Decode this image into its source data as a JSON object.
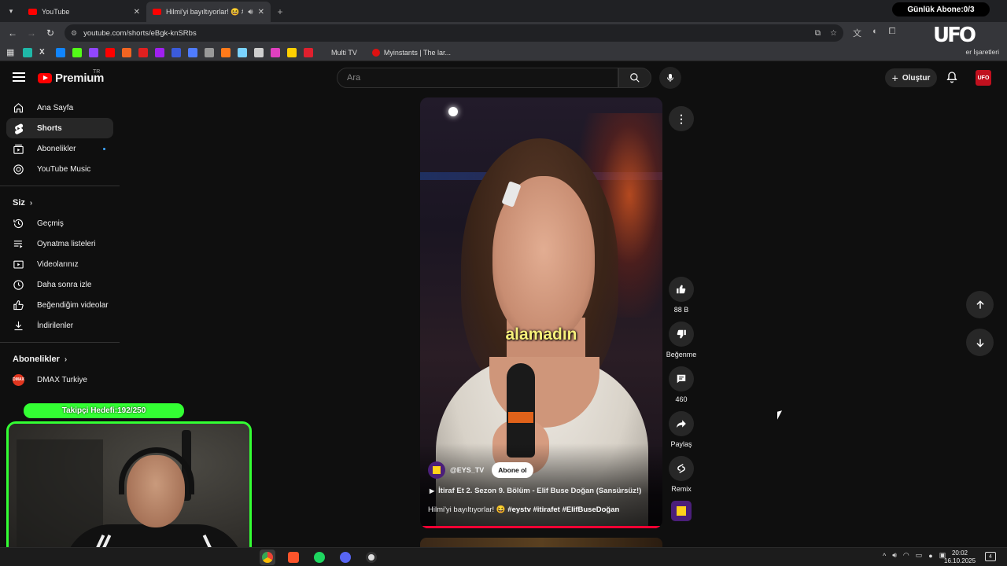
{
  "browser": {
    "tabs": [
      {
        "title": "YouTube",
        "active": false
      },
      {
        "title": "Hilmi'yi bayıltıyorlar! 😆 #e",
        "active": true
      }
    ],
    "overlay_counter": "Günlük Abone:0/3",
    "url": "youtube.com/shorts/eBgk-knSRbs",
    "bookmarks": [
      "Multi TV",
      "Myinstants | The lar..."
    ],
    "bookmarks_right": "er İşaretleri"
  },
  "yt": {
    "logo_text": "Premium",
    "logo_region": "TR",
    "search_placeholder": "Ara",
    "create_label": "Oluştur",
    "avatar_text": "UFO"
  },
  "sidebar": {
    "main": [
      {
        "label": "Ana Sayfa",
        "icon": "home-icon"
      },
      {
        "label": "Shorts",
        "icon": "shorts-icon",
        "active": true
      },
      {
        "label": "Abonelikler",
        "icon": "subscriptions-icon",
        "dot": true
      },
      {
        "label": "YouTube Music",
        "icon": "music-icon"
      }
    ],
    "you_header": "Siz",
    "you": [
      {
        "label": "Geçmiş",
        "icon": "history-icon"
      },
      {
        "label": "Oynatma listeleri",
        "icon": "playlists-icon"
      },
      {
        "label": "Videolarınız",
        "icon": "your-videos-icon"
      },
      {
        "label": "Daha sonra izle",
        "icon": "watch-later-icon"
      },
      {
        "label": "Beğendiğim videolar",
        "icon": "liked-icon"
      },
      {
        "label": "İndirilenler",
        "icon": "download-icon"
      }
    ],
    "subs_header": "Abonelikler",
    "subs": [
      {
        "label": "DMAX Turkiye"
      }
    ]
  },
  "overlay": {
    "follower_goal": "Takipçi Hedefi:192/250"
  },
  "short": {
    "caption": "alamadın",
    "channel": "@EYS_TV",
    "subscribe_label": "Abone ol",
    "linked_video": "İtiraf Et 2. Sezon 9. Bölüm - Elif Buse Doğan (Sansürsüz!)",
    "description_text": "Hilmi'yi bayıltıyorlar! 😆",
    "hashtags": "#eystv #itirafet #ElifBuseDoğan",
    "progress": 0.99
  },
  "actions": {
    "likes": "88 B",
    "dislike_label": "Beğenme",
    "comments": "460",
    "share_label": "Paylaş",
    "remix_label": "Remix"
  },
  "taskbar": {
    "time": "20:02",
    "date": "16.10.2025",
    "notifications": "4"
  },
  "colors": {
    "accent_red": "#ff0000",
    "goal_green": "#33ff33",
    "caption_yellow": "#f6f07a"
  }
}
